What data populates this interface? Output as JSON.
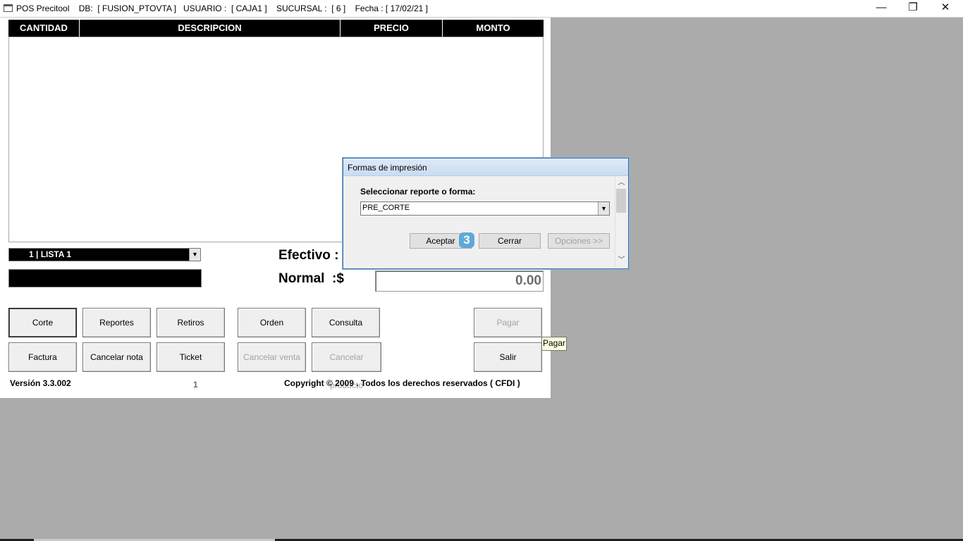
{
  "titlebar": {
    "title": "POS Precitool    DB:  [ FUSION_PTOVTA ]   USUARIO :  [ CAJA1 ]    SUCURSAL :  [ 6 ]    Fecha : [ 17/02/21 ]",
    "minimize": "—",
    "restore": "❐",
    "close": "✕"
  },
  "grid": {
    "columns": [
      "CANTIDAD",
      "DESCRIPCION",
      "PRECIO",
      "MONTO"
    ]
  },
  "price_list": {
    "selected": "1  | LISTA 1"
  },
  "totals": {
    "efectivo_label": "Efectivo :",
    "normal_label": "Normal  :$",
    "amount": "0.00"
  },
  "buttons": {
    "corte": "Corte",
    "reportes": "Reportes",
    "retiros": "Retiros",
    "orden": "Orden",
    "consulta": "Consulta",
    "pagar": "Pagar",
    "factura": "Factura",
    "cancelar_nota": "Cancelar nota",
    "ticket": "Ticket",
    "cancelar_venta": "Cancelar venta",
    "cancelar_producto": "Cancelar producto",
    "salir": "Salir"
  },
  "footer": {
    "version": "Versión 3.3.002",
    "page": "1",
    "copyright": "Copyright © 2009 . Todos los derechos reservados ( CFDI )"
  },
  "tooltip": {
    "text": "Pagar"
  },
  "dialog": {
    "title": "Formas de impresión",
    "label": "Seleccionar reporte o forma:",
    "selected_form": "PRE_CORTE",
    "aceptar": "Aceptar",
    "cerrar": "Cerrar",
    "opciones": "Opciones >>",
    "badge": "3"
  }
}
